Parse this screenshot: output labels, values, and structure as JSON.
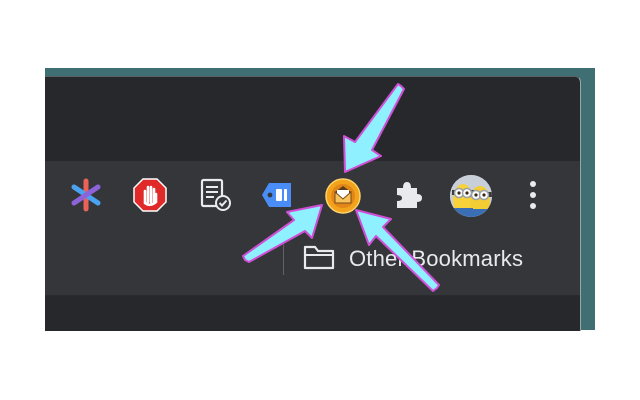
{
  "bookmarks_bar": {
    "other_bookmarks_label": "Other Bookmarks"
  },
  "toolbar": {
    "extensions": [
      {
        "name": "asterisk-extension-icon"
      },
      {
        "name": "adblock-hand-icon"
      },
      {
        "name": "document-check-icon"
      },
      {
        "name": "price-tag-extension-icon"
      },
      {
        "name": "mail-envelope-extension-icon"
      },
      {
        "name": "extensions-puzzle-icon"
      },
      {
        "name": "profile-avatar"
      },
      {
        "name": "chrome-menu-kebab-icon"
      }
    ]
  },
  "colors": {
    "window_bg": "#27282c",
    "toolbar_bg": "#35363a",
    "arrow_fill": "#8ff0ff",
    "arrow_outline": "#d14fd6",
    "highlight_icon": "#f2a31b"
  }
}
